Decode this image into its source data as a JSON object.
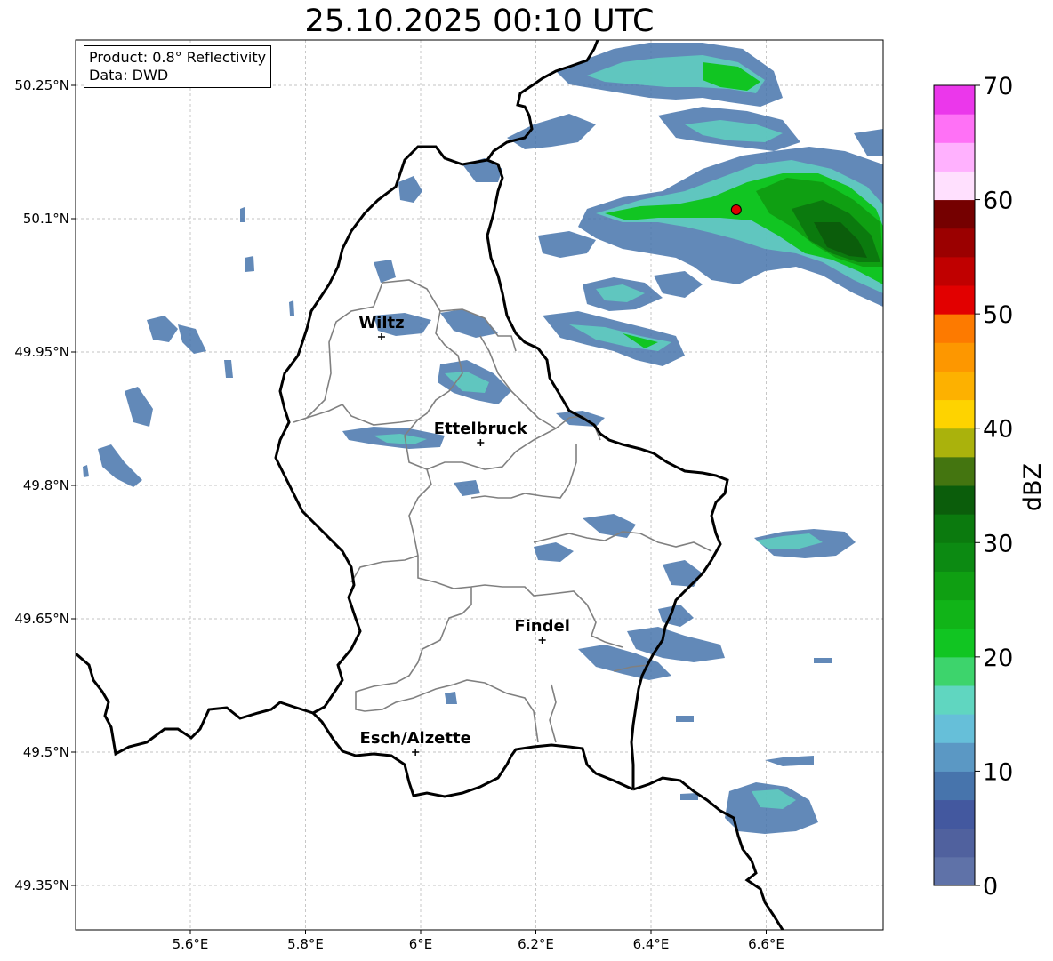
{
  "title": "25.10.2025 00:10 UTC",
  "info": {
    "product_line": "Product: 0.8° Reflectivity",
    "data_line": "Data: DWD"
  },
  "map": {
    "lat_ticks": [
      {
        "value": 50.25,
        "label": "50.25°N"
      },
      {
        "value": 50.1,
        "label": "50.1°N"
      },
      {
        "value": 49.95,
        "label": "49.95°N"
      },
      {
        "value": 49.8,
        "label": "49.8°N"
      },
      {
        "value": 49.65,
        "label": "49.65°N"
      },
      {
        "value": 49.5,
        "label": "49.5°N"
      },
      {
        "value": 49.35,
        "label": "49.35°N"
      }
    ],
    "lon_ticks": [
      {
        "value": 5.6,
        "label": "5.6°E"
      },
      {
        "value": 5.8,
        "label": "5.8°E"
      },
      {
        "value": 6.0,
        "label": "6°E"
      },
      {
        "value": 6.2,
        "label": "6.2°E"
      },
      {
        "value": 6.4,
        "label": "6.4°E"
      },
      {
        "value": 6.6,
        "label": "6.6°E"
      }
    ],
    "cities": [
      {
        "name": "Wiltz",
        "lon": 5.932,
        "lat": 49.967
      },
      {
        "name": "Ettelbruck",
        "lon": 6.104,
        "lat": 49.848
      },
      {
        "name": "Findel",
        "lon": 6.211,
        "lat": 49.626
      },
      {
        "name": "Esch/Alzette",
        "lon": 5.991,
        "lat": 49.5
      }
    ],
    "radar_site": {
      "lon": 6.548,
      "lat": 50.11,
      "color": "#e00000"
    },
    "grid_lines": true
  },
  "colorbar": {
    "label": "dBZ",
    "ticks": [
      {
        "value": 0,
        "label": "0"
      },
      {
        "value": 10,
        "label": "10"
      },
      {
        "value": 20,
        "label": "20"
      },
      {
        "value": 30,
        "label": "30"
      },
      {
        "value": 40,
        "label": "40"
      },
      {
        "value": 50,
        "label": "50"
      },
      {
        "value": 60,
        "label": "60"
      },
      {
        "value": 70,
        "label": "70"
      }
    ],
    "colors": [
      "#5f72a8",
      "#50619e",
      "#43589f",
      "#4774ac",
      "#5b98c4",
      "#66bfd9",
      "#60d6c0",
      "#3dd46c",
      "#11c522",
      "#11b418",
      "#0f9f12",
      "#0c8a12",
      "#0b7a0e",
      "#0b5d0b",
      "#447510",
      "#aab20c",
      "#fed300",
      "#fdb100",
      "#fd9700",
      "#fd7a00",
      "#e20000",
      "#c00000",
      "#9b0000",
      "#750000",
      "#ffe0fe",
      "#ffb1fe",
      "#ff71f6",
      "#eb37eb"
    ]
  }
}
